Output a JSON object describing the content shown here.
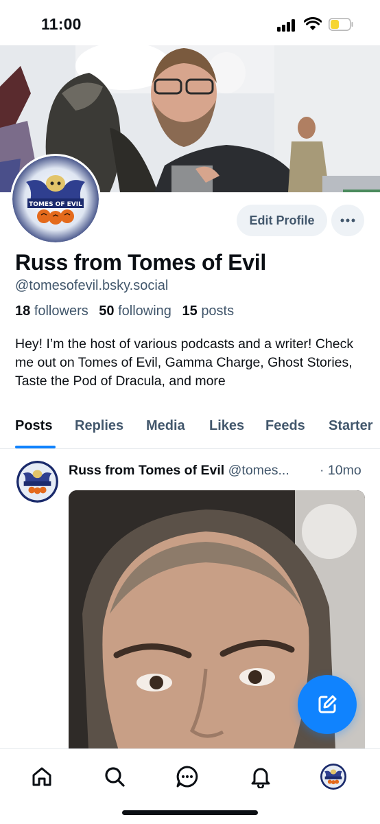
{
  "status_bar": {
    "time": "11:00"
  },
  "profile": {
    "display_name": "Russ from Tomes of Evil",
    "handle": "@tomesofevil.bsky.social",
    "avatar_logo_text": "TOMES OF EVIL",
    "stats": {
      "followers_count": "18",
      "followers_label": "followers",
      "following_count": "50",
      "following_label": "following",
      "posts_count": "15",
      "posts_label": "posts"
    },
    "bio": "Hey! I’m the host of various podcasts and a writer! Check me out on Tomes of Evil, Gamma Charge, Ghost Stories, Taste the Pod of Dracula, and more"
  },
  "actions": {
    "edit_profile_label": "Edit Profile",
    "more_icon": "ellipsis-icon"
  },
  "tabs": [
    {
      "label": "Posts",
      "active": true
    },
    {
      "label": "Replies",
      "active": false
    },
    {
      "label": "Media",
      "active": false
    },
    {
      "label": "Likes",
      "active": false
    },
    {
      "label": "Feeds",
      "active": false
    },
    {
      "label": "Starter",
      "active": false
    }
  ],
  "post": {
    "author": "Russ from Tomes of Evil",
    "handle": "@tomes...",
    "time": "· 10mo"
  },
  "bottom_nav": [
    {
      "icon": "home-icon"
    },
    {
      "icon": "search-icon"
    },
    {
      "icon": "chat-icon"
    },
    {
      "icon": "bell-icon"
    },
    {
      "icon": "profile-avatar"
    }
  ],
  "colors": {
    "accent": "#1083fe",
    "muted_text": "#42576c",
    "button_bg": "#eef2f6",
    "text": "#0b0f14"
  }
}
